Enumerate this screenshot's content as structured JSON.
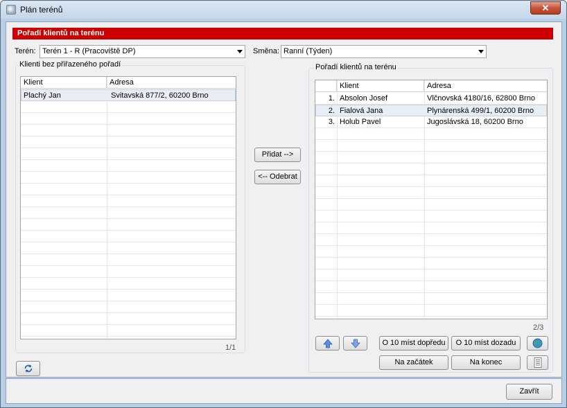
{
  "window": {
    "title": "Plán terénů",
    "close_glyph": "✕"
  },
  "header": {
    "title": "Pořadí klientů na terénu"
  },
  "filters": {
    "teren_label": "Terén:",
    "teren_value": "Terén 1 - R (Pracoviště DP)",
    "smena_label": "Směna:",
    "smena_value": "Ranní (Týden)"
  },
  "left_group": {
    "title": "Klienti bez přiřazeného pořadí",
    "columns": [
      "Klient",
      "Adresa"
    ],
    "rows": [
      {
        "klient": "Plachý Jan",
        "adresa": "Svitavská 877/2, 60200 Brno"
      }
    ],
    "counter": "1/1"
  },
  "middle": {
    "add_label": "Přidat -->",
    "remove_label": "<-- Odebrat"
  },
  "right_group": {
    "title": "Pořadí klientů na terénu",
    "columns": [
      "",
      "Klient",
      "Adresa"
    ],
    "rows": [
      {
        "num": "1.",
        "klient": "Absolon Josef",
        "adresa": "Vlčnovská 4180/16, 62800 Brno"
      },
      {
        "num": "2.",
        "klient": "Fialová Jana",
        "adresa": "Plynárenská 499/1, 60200 Brno"
      },
      {
        "num": "3.",
        "klient": "Holub Pavel",
        "adresa": "Jugoslávská 18, 60200 Brno"
      }
    ],
    "counter": "2/3",
    "move_up_icon": "arrow-up-icon",
    "move_down_icon": "arrow-down-icon",
    "forward10_label": "O 10 míst dopředu",
    "back10_label": "O 10 míst dozadu",
    "to_start_label": "Na začátek",
    "to_end_label": "Na konec",
    "map_icon": "globe-icon",
    "print_icon": "document-icon"
  },
  "refresh_icon": "refresh-icon",
  "footer": {
    "close_label": "Zavřít"
  }
}
